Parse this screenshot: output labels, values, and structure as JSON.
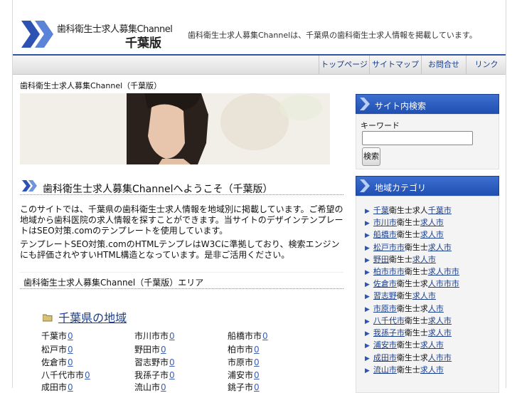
{
  "header": {
    "logo_title": "歯科衛生士求人募集Channel",
    "logo_sub": "千葉版",
    "tagline": "歯科衛生士求人募集Channelは、千葉県の歯科衛生士求人情報を掲載しています。"
  },
  "nav": [
    "トップページ",
    "サイトマップ",
    "お問合せ",
    "リンク"
  ],
  "breadcrumb": "歯科衛生士求人募集Channel（千葉版）",
  "main": {
    "title": "歯科衛生士求人募集Channelへようこそ（千葉版）",
    "para1": "このサイトでは、千葉県の歯科衛生士求人情報を地域別に掲載しています。ご希望の地域から歯科医院の求人情報を探すことができます。当サイトのデザインテンプレートはSEO対策.comのテンプレートを使用しています。",
    "para2": "テンプレートSEO対策.comのHTMLテンプレはW3Cに準拠しており、検索エンジンにも評価されやすいHTML構造となっています。是非ご活用ください。",
    "subtitle": "歯科衛生士求人募集Channel（千葉版）エリア",
    "section_label": "千葉県の地域",
    "areas": [
      {
        "name": "千葉市",
        "count": "0"
      },
      {
        "name": "市川市市",
        "count": "0"
      },
      {
        "name": "船橋市市",
        "count": "0"
      },
      {
        "name": "松戸市",
        "count": "0"
      },
      {
        "name": "野田市",
        "count": "0"
      },
      {
        "name": "柏市市",
        "count": "0"
      },
      {
        "name": "佐倉市",
        "count": "0"
      },
      {
        "name": "習志野市",
        "count": "0"
      },
      {
        "name": "市原市",
        "count": "0"
      },
      {
        "name": "八千代市市",
        "count": "0"
      },
      {
        "name": "我孫子市",
        "count": "0"
      },
      {
        "name": "浦安市",
        "count": "0"
      },
      {
        "name": "成田市",
        "count": "0"
      },
      {
        "name": "流山市",
        "count": "0"
      },
      {
        "name": "銚子市",
        "count": "0"
      }
    ]
  },
  "sidebar": {
    "search_title": "サイト内検索",
    "search_label": "キーワード",
    "search_input_value": "",
    "search_button": "検索",
    "category_title": "地域カテゴリ",
    "categories": [
      {
        "a": "千葉",
        "b": "衛生士求人",
        "c": "千葉市"
      },
      {
        "a": "市川市",
        "b": "衛生士",
        "c": "求人市"
      },
      {
        "a": "船橋市",
        "b": "衛生士",
        "c": "求人市"
      },
      {
        "a": "松戸市市",
        "b": "衛生士",
        "c": "求人市"
      },
      {
        "a": "野田",
        "b": "衛生士",
        "c": "求人市"
      },
      {
        "a": "柏市市市",
        "b": "衛生士",
        "c": "求人市市"
      },
      {
        "a": "佐倉市",
        "b": "衛生士求",
        "c": "人市市市"
      },
      {
        "a": "習志野",
        "b": "衛生",
        "c": "求人市"
      },
      {
        "a": "市原市",
        "b": "衛生士求",
        "c": "人市"
      },
      {
        "a": "八千代市",
        "b": "衛生士",
        "c": "求人市"
      },
      {
        "a": "我孫子市",
        "b": "衛生士",
        "c": "求人市"
      },
      {
        "a": "浦安市",
        "b": "衛生士",
        "c": "求人市"
      },
      {
        "a": "成田市",
        "b": "衛生士求",
        "c": "人市市"
      },
      {
        "a": "流山市",
        "b": "衛生士",
        "c": "求人市"
      }
    ]
  }
}
